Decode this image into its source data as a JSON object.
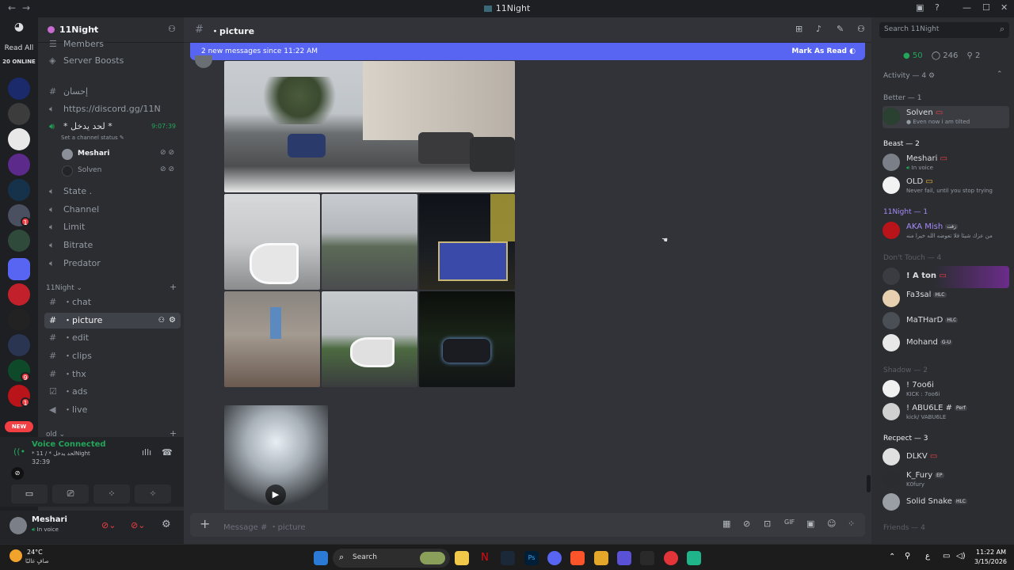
{
  "window": {
    "title": "11Night",
    "back": "←",
    "forward": "→"
  },
  "rail": {
    "read_all": "Read All",
    "online": "20 ONLINE",
    "new_badge": "NEW",
    "badges": [
      "1",
      "1",
      "9",
      "1"
    ]
  },
  "server": {
    "name": "11Night",
    "items_top": [
      {
        "label": "Members"
      },
      {
        "label": "Server Boosts"
      }
    ],
    "channels_upper": [
      {
        "label": "إحسان"
      },
      {
        "label": "https://discord.gg/11N"
      }
    ],
    "voice_channel": {
      "name": "* لحد يدخل *",
      "time": "9:07:39",
      "status_hint": "Set a channel status",
      "users": [
        "Meshari",
        "Solven"
      ]
    },
    "stage_channels": [
      "State .",
      "Channel",
      "Limit",
      "Bitrate",
      "Predator"
    ],
    "category": "11Night",
    "text_channels": [
      "chat",
      "picture",
      "edit",
      "clips",
      "thx",
      "ads",
      "live"
    ],
    "category_old": "old"
  },
  "voice_panel": {
    "status": "Voice Connected",
    "channel": "* لحد يدخل * / 11Night",
    "timer": "32:39"
  },
  "user_panel": {
    "name": "Meshari",
    "status": "In voice"
  },
  "main": {
    "channel": "picture",
    "banner_text": "2 new messages since 11:22 AM",
    "mark_read": "Mark As Read",
    "composer_placeholder": "Message # ・picture",
    "plus": "+"
  },
  "members": {
    "search_placeholder": "Search 11Night",
    "stats": {
      "online": "50",
      "idle": "246",
      "voice": "2"
    },
    "activity": "Activity — 4",
    "groups": [
      {
        "title": "Better — 1",
        "members": [
          {
            "name": "Solven",
            "status": "Even now i am tilted"
          }
        ]
      },
      {
        "title": "Beast — 2",
        "members": [
          {
            "name": "Meshari",
            "status": "In voice"
          },
          {
            "name": "OLD",
            "status": "Never fail, until you stop trying"
          }
        ]
      },
      {
        "title": "11Night — 1",
        "members": [
          {
            "name": "AKA Mish",
            "tag": "زفت",
            "status": "من عزك شيئا فلا تعوضه الله خيرا منه"
          }
        ]
      },
      {
        "title": "Don't Touch — 4",
        "members": [
          {
            "name": "! A ton",
            "status": ""
          },
          {
            "name": "Fa3sal",
            "tag": "HLC",
            "status": ""
          },
          {
            "name": "MaTHarD",
            "tag": "HLC",
            "status": ""
          },
          {
            "name": "Mohand",
            "tag": "G-U",
            "status": ""
          }
        ]
      },
      {
        "title": "Shadow — 2",
        "members": [
          {
            "name": "! 7oo6i",
            "status": "KICK : 7oo6i"
          },
          {
            "name": "! ABU6LE #",
            "tag": "Perf",
            "status": "kick/ VABU6LE"
          }
        ]
      },
      {
        "title": "Recpect — 3",
        "members": [
          {
            "name": "DLKV",
            "status": ""
          },
          {
            "name": "K_Fury",
            "tag": "EP",
            "status": "K0fury"
          },
          {
            "name": "Solid Snake",
            "tag": "HLC",
            "status": ""
          }
        ]
      },
      {
        "title": "Friends — 4",
        "members": []
      }
    ]
  },
  "taskbar": {
    "weather_temp": "24°C",
    "weather_desc": "صافٍ غالبًا",
    "search": "Search",
    "time": "11:22 AM",
    "date": "3/15/2026",
    "lang": "ع"
  },
  "colors": {
    "accent": "#5865f2",
    "online": "#23a55a",
    "rail_bg": "#1e1f22",
    "sidebar_bg": "#2b2d31",
    "main_bg": "#313338"
  }
}
